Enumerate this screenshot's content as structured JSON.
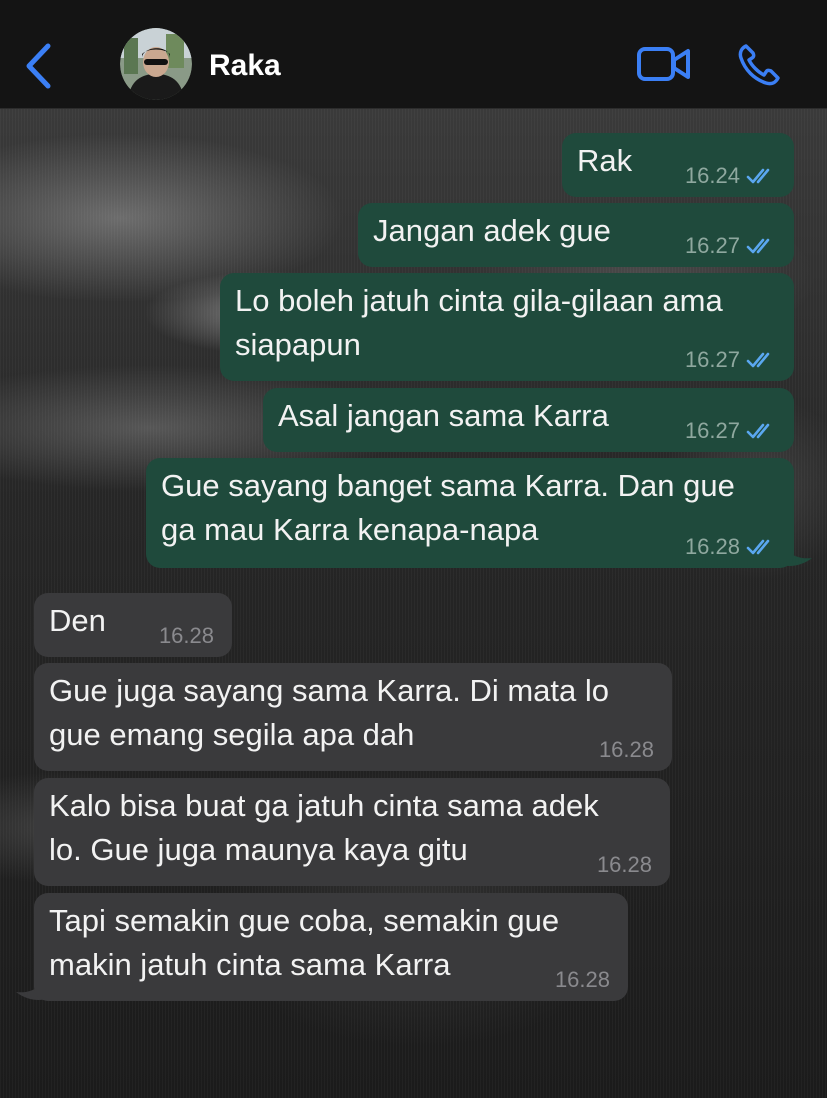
{
  "header": {
    "contact_name": "Raka",
    "back_icon": "chevron-left-icon",
    "video_icon": "video-camera-icon",
    "phone_icon": "phone-icon",
    "accent_color": "#3b7ff5"
  },
  "messages": [
    {
      "direction": "outgoing",
      "lines": [
        "Rak"
      ],
      "time": "16.24",
      "status": "read"
    },
    {
      "direction": "outgoing",
      "lines": [
        "Jangan adek gue"
      ],
      "time": "16.27",
      "status": "read"
    },
    {
      "direction": "outgoing",
      "lines": [
        "Lo boleh jatuh cinta gila-gilaan ama",
        "siapapun"
      ],
      "time": "16.27",
      "status": "read"
    },
    {
      "direction": "outgoing",
      "lines": [
        "Asal jangan sama Karra"
      ],
      "time": "16.27",
      "status": "read"
    },
    {
      "direction": "outgoing",
      "lines": [
        "Gue sayang banget sama Karra. Dan gue",
        "ga mau Karra kenapa-napa"
      ],
      "time": "16.28",
      "status": "read"
    },
    {
      "direction": "incoming",
      "lines": [
        "Den"
      ],
      "time": "16.28"
    },
    {
      "direction": "incoming",
      "lines": [
        "Gue juga sayang sama Karra. Di mata lo",
        "gue emang segila apa dah"
      ],
      "time": "16.28"
    },
    {
      "direction": "incoming",
      "lines": [
        "Kalo bisa buat ga jatuh cinta sama adek",
        "lo. Gue juga maunya kaya gitu"
      ],
      "time": "16.28"
    },
    {
      "direction": "incoming",
      "lines": [
        "Tapi semakin gue coba, semakin gue",
        "makin jatuh cinta sama Karra"
      ],
      "time": "16.28"
    }
  ],
  "colors": {
    "outgoing_bubble": "#1f4a3c",
    "incoming_bubble": "#3a3a3c",
    "read_ticks": "#5aa7f0"
  }
}
